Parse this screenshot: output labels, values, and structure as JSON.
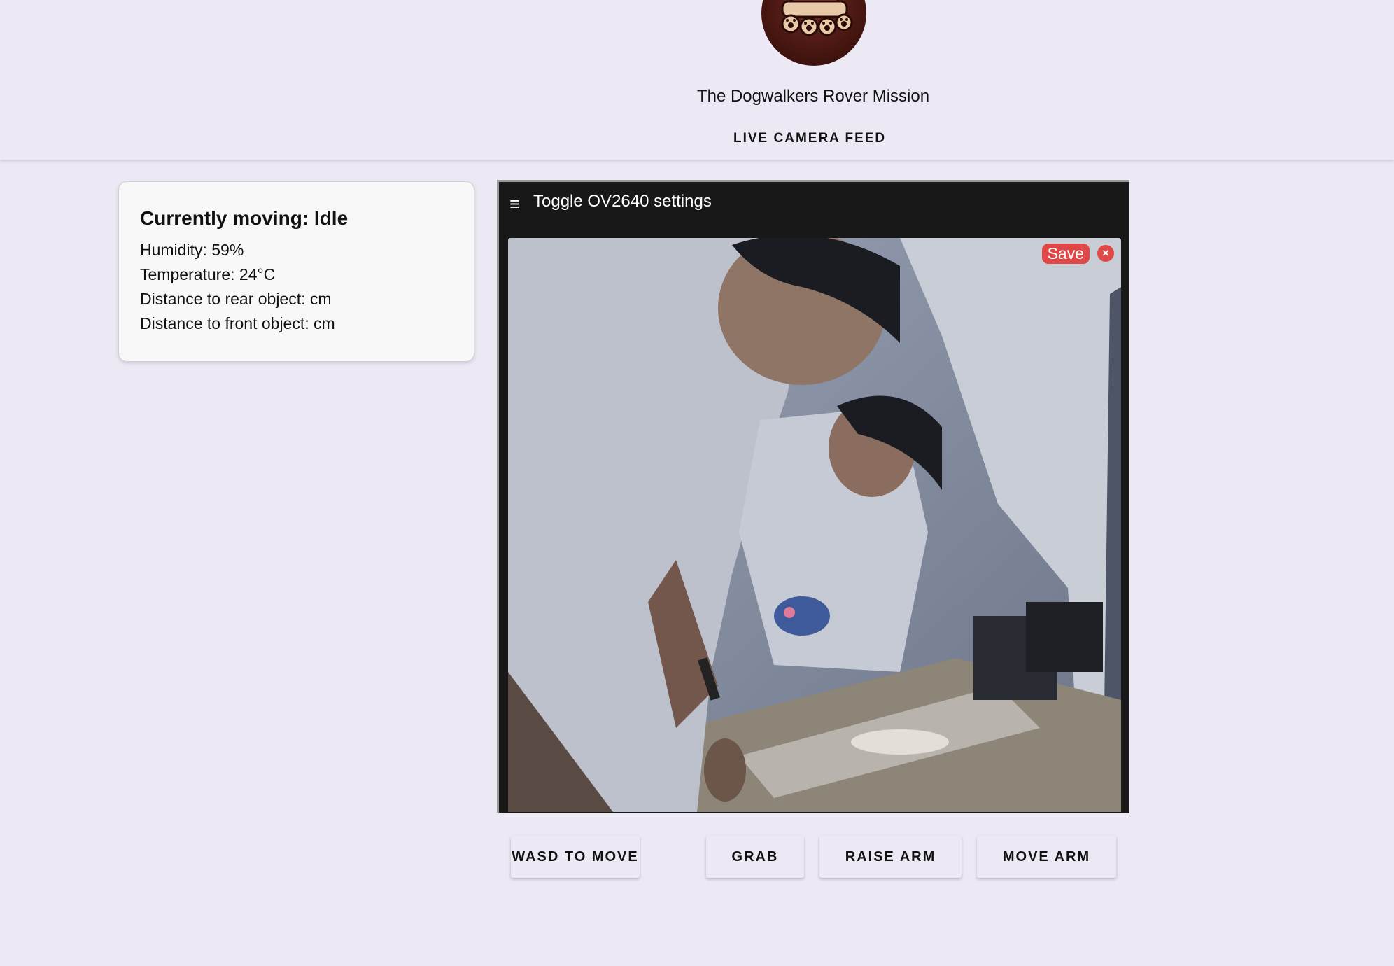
{
  "header": {
    "logo_alt": "rover-logo",
    "title": "The Dogwalkers Rover Mission"
  },
  "nav": {
    "live_feed": "LIVE CAMERA FEED"
  },
  "status": {
    "moving": "Currently moving: Idle",
    "humidity": "Humidity: 59%",
    "temperature": "Temperature: 24°C",
    "rear_distance": "Distance to rear object: cm",
    "front_distance": "Distance to front object: cm"
  },
  "camera": {
    "menu_icon": "≡",
    "toggle_label": "Toggle OV2640 settings",
    "save_label": "Save",
    "close_label": "×"
  },
  "controls": {
    "wasd": "WASD TO MOVE",
    "grab": "GRAB",
    "raise_arm": "RAISE ARM",
    "move_arm": "MOVE ARM"
  },
  "colors": {
    "page_bg": "#ece8f4",
    "panel_bg": "#181818",
    "accent_red": "#e04848"
  }
}
